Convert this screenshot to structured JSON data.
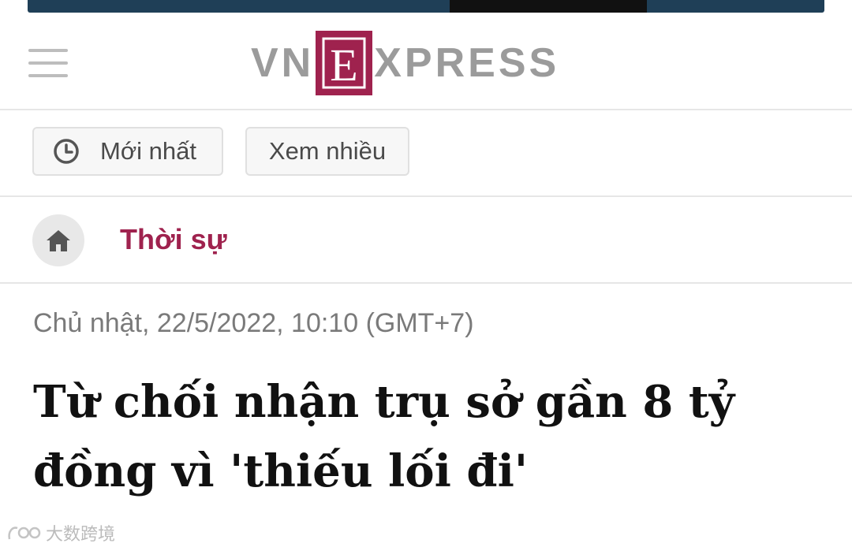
{
  "header": {
    "logo": {
      "prefix": "VN",
      "letter": "E",
      "suffix": "XPRESS"
    },
    "menu_icon": "hamburger-menu-icon"
  },
  "tabs": [
    {
      "label": "Mới nhất",
      "icon": "clock-icon"
    },
    {
      "label": "Xem nhiều"
    }
  ],
  "breadcrumb": {
    "home_icon": "home-icon",
    "category": "Thời sự"
  },
  "article": {
    "date": "Chủ nhật, 22/5/2022, 10:10 (GMT+7)",
    "title": "Từ chối nhận trụ sở gần 8 tỷ đồng vì 'thiếu lối đi'"
  },
  "watermark": {
    "text": "大数跨境"
  },
  "colors": {
    "brand": "#9f224e",
    "logo_gray": "#9b9b9b",
    "banner": "#1f3f57"
  }
}
